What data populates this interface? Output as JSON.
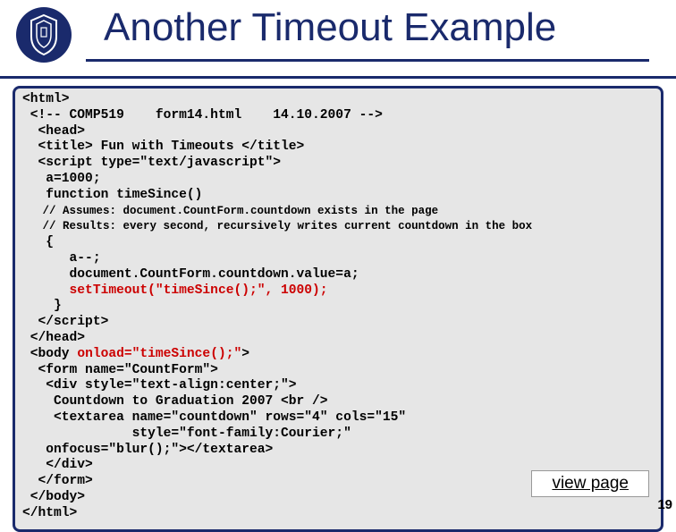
{
  "title": "Another Timeout Example",
  "code": {
    "l1": "<html>",
    "l2": " <!-- COMP519    form14.html    14.10.2007 -->",
    "l3": "  <head>",
    "l4": "  <title> Fun with Timeouts </title>",
    "l5": "  <script type=\"text/javascript\">",
    "l6": "   a=1000;",
    "l7": "   function timeSince()",
    "c1": "   // Assumes: document.CountForm.countdown exists in the page",
    "c2": "   // Results: every second, recursively writes current countdown in the box",
    "l8": "   {",
    "l9": "      a--;",
    "l10": "      document.CountForm.countdown.value=a;",
    "l11_a": "      ",
    "l11_b": "setTimeout(\"timeSince();\", 1000);",
    "l12": "    }",
    "l13": "  </script>",
    "l14": " </head>",
    "l15_a": " <body ",
    "l15_b": "onload=\"timeSince();\"",
    "l15_c": ">",
    "l16": "  <form name=\"CountForm\">",
    "l17": "   <div style=\"text-align:center;\">",
    "l18": "    Countdown to Graduation 2007 <br />",
    "l19": "    <textarea name=\"countdown\" rows=\"4\" cols=\"15\"",
    "l20": "              style=\"font-family:Courier;\"",
    "l21": "   onfocus=\"blur();\"></textarea>",
    "l22": "   </div>",
    "l23": "  </form>",
    "l24": " </body>",
    "l25": "</html>"
  },
  "view_page_label": "view page",
  "page_number": "19"
}
